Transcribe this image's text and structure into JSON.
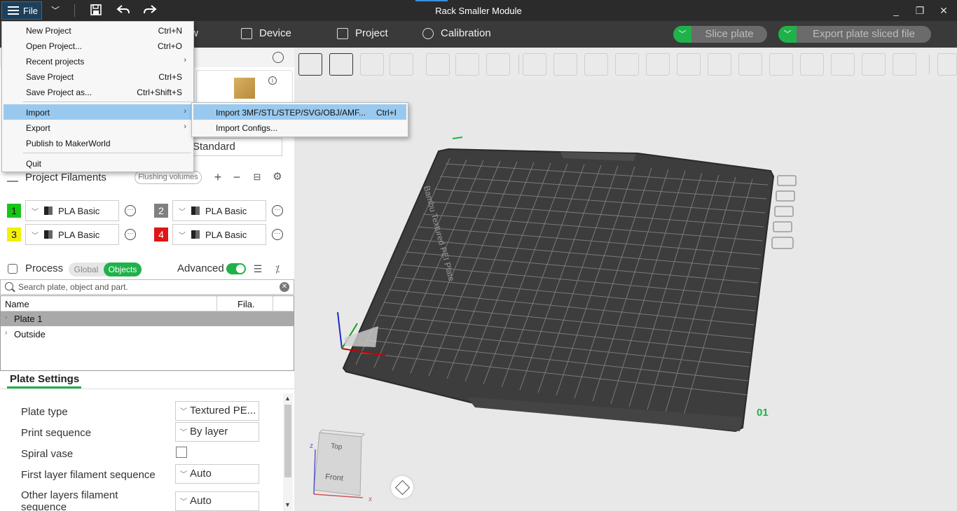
{
  "window": {
    "title": "Rack Smaller Module",
    "file_label": "File",
    "controls": [
      "_",
      "❐",
      "✕"
    ]
  },
  "nav": {
    "tabs": [
      {
        "label": "Device"
      },
      {
        "label": "Project"
      },
      {
        "label": "Calibration"
      }
    ],
    "tab_partial": "w",
    "slice_label": "Slice plate",
    "export_label": "Export plate sliced file"
  },
  "file_menu": {
    "items": [
      {
        "label": "New Project",
        "shortcut": "Ctrl+N"
      },
      {
        "label": "Open Project...",
        "shortcut": "Ctrl+O"
      },
      {
        "label": "Recent projects",
        "shortcut": ""
      },
      {
        "label": "Save Project",
        "shortcut": "Ctrl+S"
      },
      {
        "label": "Save Project as...",
        "shortcut": "Ctrl+Shift+S"
      },
      {
        "label": "Import",
        "shortcut": ""
      },
      {
        "label": "Export",
        "shortcut": ""
      },
      {
        "label": "Publish to MakerWorld",
        "shortcut": ""
      },
      {
        "label": "Quit",
        "shortcut": ""
      }
    ],
    "import_submenu": [
      {
        "label": "Import 3MF/STL/STEP/SVG/OBJ/AMF...",
        "shortcut": "Ctrl+I"
      },
      {
        "label": "Import Configs...",
        "shortcut": ""
      }
    ]
  },
  "left": {
    "standard_value": "Standard",
    "project_filaments": {
      "title": "Project Filaments",
      "flushing_label": "Flushing volumes",
      "filaments": [
        {
          "num": "1",
          "name": "PLA Basic",
          "color": "#18c418"
        },
        {
          "num": "2",
          "name": "PLA Basic",
          "color": "#808080"
        },
        {
          "num": "3",
          "name": "PLA Basic",
          "color": "#f2ef0c"
        },
        {
          "num": "4",
          "name": "PLA Basic",
          "color": "#e01515"
        }
      ]
    },
    "process": {
      "title": "Process",
      "global_label": "Global",
      "objects_label": "Objects",
      "advanced_label": "Advanced"
    },
    "search_placeholder": "Search plate, object and part.",
    "object_list": {
      "col_name": "Name",
      "col_fila": "Fila.",
      "rows": [
        {
          "name": "Plate 1",
          "selected": true
        },
        {
          "name": "Outside",
          "selected": false
        }
      ]
    },
    "plate_settings": {
      "title": "Plate Settings",
      "rows": [
        {
          "label": "Plate type",
          "value": "Textured PE..."
        },
        {
          "label": "Print sequence",
          "value": "By layer"
        },
        {
          "label": "Spiral vase",
          "value": ""
        },
        {
          "label": "First layer filament sequence",
          "value": "Auto"
        },
        {
          "label": "Other layers filament sequence",
          "value": "Auto"
        }
      ]
    }
  },
  "viewport": {
    "plate_label": "Bambu Textured PEI Plate",
    "plate_number": "01",
    "cube_top": "Top",
    "cube_front": "Front",
    "axis_x": "x",
    "axis_z": "z"
  },
  "colors": {
    "accent_green": "#20b24a",
    "menu_highlight": "#99c9ef",
    "plate_dark": "#3a3a3a"
  }
}
